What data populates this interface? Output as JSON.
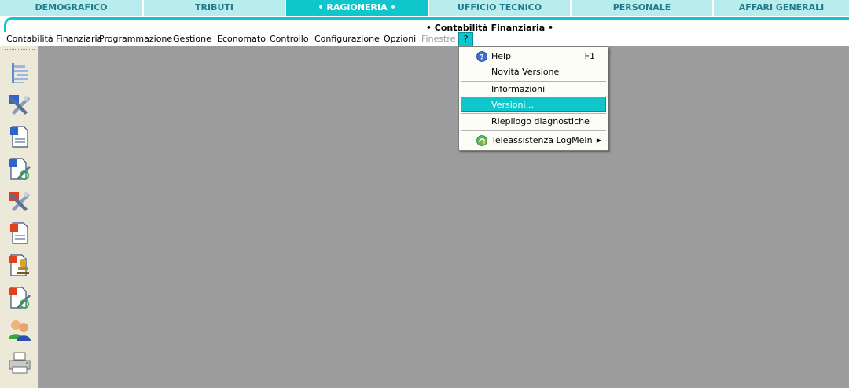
{
  "modules": {
    "tabs": [
      {
        "label": "DEMOGRAFICO"
      },
      {
        "label": "TRIBUTI"
      },
      {
        "label": "• RAGIONERIA •"
      },
      {
        "label": "UFFICIO TECNICO"
      },
      {
        "label": "PERSONALE"
      },
      {
        "label": "AFFARI GENERALI"
      }
    ]
  },
  "header": {
    "title": "• Contabilità Finanziaria •"
  },
  "menubar": {
    "items": [
      {
        "label": "Contabilità Finanziaria"
      },
      {
        "label": "Programmazione"
      },
      {
        "label": "Gestione"
      },
      {
        "label": "Economato"
      },
      {
        "label": "Controllo"
      },
      {
        "label": "Configurazione"
      },
      {
        "label": "Opzioni"
      },
      {
        "label": "Finestre"
      },
      {
        "label": "?"
      }
    ]
  },
  "help_menu": {
    "items": [
      {
        "label": "Help",
        "shortcut": "F1",
        "icon": "help-circle-icon"
      },
      {
        "label": "Novità Versione"
      },
      {
        "label": "Informazioni"
      },
      {
        "label": "Versioni..."
      },
      {
        "label": "Riepilogo diagnostiche"
      },
      {
        "label": "Teleassistenza LogMeIn",
        "icon": "logmein-icon",
        "submenu_arrow": "▶"
      }
    ],
    "selected": "Versioni..."
  },
  "toolbar": {
    "buttons": [
      {
        "icon": "tree-list-icon"
      },
      {
        "icon": "blue-tools-icon"
      },
      {
        "icon": "blue-document-icon"
      },
      {
        "icon": "blue-document-tools-icon"
      },
      {
        "icon": "red-tools-icon"
      },
      {
        "icon": "red-document-icon"
      },
      {
        "icon": "stamp-document-icon"
      },
      {
        "icon": "red-document-tools-icon"
      },
      {
        "icon": "users-icon"
      },
      {
        "icon": "printer-icon"
      }
    ]
  },
  "colors": {
    "accent": "#0fc6cc",
    "tab_inactive": "#b9ecec",
    "tab_text": "#1f7b8c",
    "workspace": "#9c9c9c",
    "toolbar_bg": "#ece9d8"
  }
}
